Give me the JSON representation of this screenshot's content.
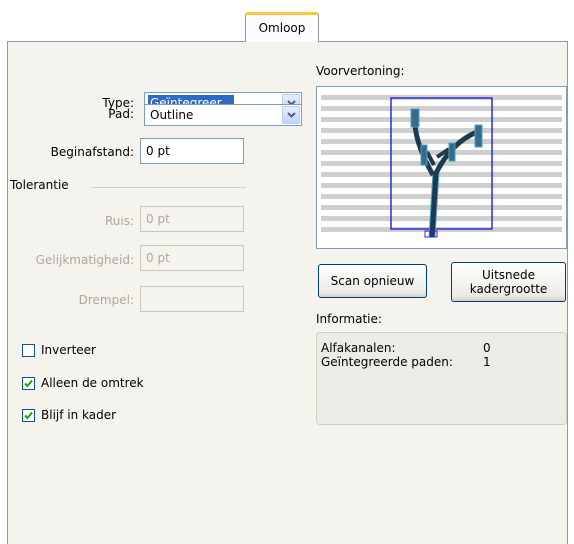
{
  "tab": {
    "label": "Omloop"
  },
  "type": {
    "label": "Type:",
    "value": "Geïntegreer..."
  },
  "pad": {
    "label": "Pad:",
    "value": "Outline"
  },
  "beginafstand": {
    "label": "Beginafstand:",
    "value": "0 pt"
  },
  "tolerantie": {
    "title": "Tolerantie",
    "ruis_label": "Ruis:",
    "ruis_value": "0 pt",
    "gelijk_label": "Gelijkmatigheid:",
    "gelijk_value": "0 pt",
    "drempel_label": "Drempel:",
    "drempel_value": ""
  },
  "checkboxes": [
    {
      "label": "Inverteer",
      "checked": false
    },
    {
      "label": "Alleen de omtrek",
      "checked": true
    },
    {
      "label": "Blijf in kader",
      "checked": true
    }
  ],
  "preview": {
    "title": "Voorvertoning:"
  },
  "buttons": {
    "rescan": "Scan opnieuw",
    "crop_line1": "Uitsnede",
    "crop_line2": "kadergrootte"
  },
  "info": {
    "title": "Informatie:",
    "alpha_label": "Alfakanalen:",
    "alpha_value": "0",
    "paths_label": "Geïntegreerde paden:",
    "paths_value": "1"
  },
  "colors": {
    "accent_tab": "#ffc83c",
    "selection": "#316ac5",
    "check": "#21a121"
  }
}
